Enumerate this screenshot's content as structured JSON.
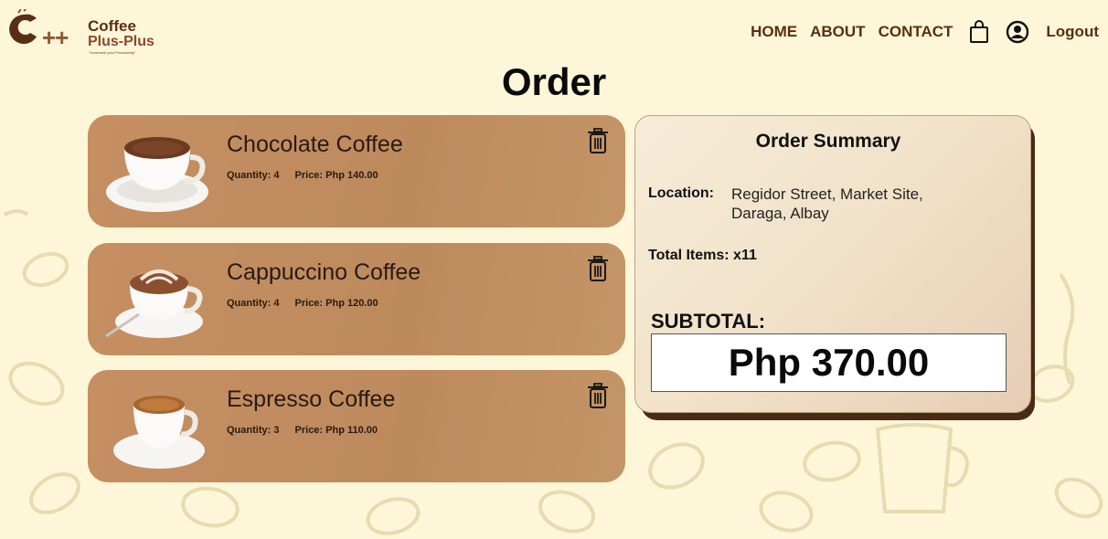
{
  "brand": {
    "symbol": "++",
    "name_line1": "Coffee",
    "name_line2": "Plus-Plus",
    "tagline": "\"Increment your Productivity\""
  },
  "nav": {
    "home": "HOME",
    "about": "ABOUT",
    "contact": "CONTACT",
    "cart_icon": "shopping-bag-icon",
    "profile_icon": "user-circle-icon",
    "logout": "Logout"
  },
  "page": {
    "title": "Order"
  },
  "order_items": [
    {
      "name": "Chocolate Coffee",
      "quantity": "Quantity: 4",
      "price": "Price: Php 140.00",
      "image": "chocolate-coffee-cup"
    },
    {
      "name": "Cappuccino Coffee",
      "quantity": "Quantity: 4",
      "price": "Price: Php 120.00",
      "image": "cappuccino-cup"
    },
    {
      "name": "Espresso Coffee",
      "quantity": "Quantity: 3",
      "price": "Price: Php 110.00",
      "image": "espresso-cup"
    }
  ],
  "summary": {
    "title": "Order Summary",
    "location_label": "Location:",
    "location_value": "Regidor Street, Market Site, Daraga, Albay",
    "total_items": "Total Items: x11",
    "subtotal_label": "SUBTOTAL:",
    "subtotal_value": "Php 370.00"
  },
  "colors": {
    "background": "#fdf6d8",
    "card": "#c08c60",
    "nav_text": "#5a2e14",
    "summary_shadow": "#4a2a12"
  }
}
